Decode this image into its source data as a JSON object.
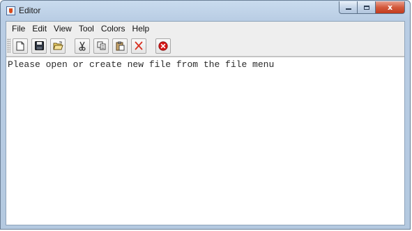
{
  "window": {
    "title": "Editor",
    "app_icon": "java-cup-icon",
    "caption_buttons": {
      "minimize_icon": "minimize-icon",
      "maximize_icon": "maximize-icon",
      "close_label": "x"
    }
  },
  "menubar": {
    "items": [
      {
        "label": "File"
      },
      {
        "label": "Edit"
      },
      {
        "label": "View"
      },
      {
        "label": "Tool"
      },
      {
        "label": "Colors"
      },
      {
        "label": "Help"
      }
    ]
  },
  "toolbar": {
    "buttons": [
      {
        "icon": "new-file-icon"
      },
      {
        "icon": "save-icon"
      },
      {
        "icon": "open-folder-icon"
      },
      {
        "icon": "cut-icon"
      },
      {
        "icon": "copy-icon"
      },
      {
        "icon": "paste-icon"
      },
      {
        "icon": "delete-icon"
      },
      {
        "icon": "exit-icon"
      }
    ]
  },
  "editor": {
    "text": "Please open or create new file from the file menu"
  },
  "colors": {
    "title_bar": "#c9dbee",
    "close_button": "#c23a1c",
    "delete_icon": "#d83020",
    "exit_icon": "#d81818",
    "editor_bg": "#ffffff"
  }
}
